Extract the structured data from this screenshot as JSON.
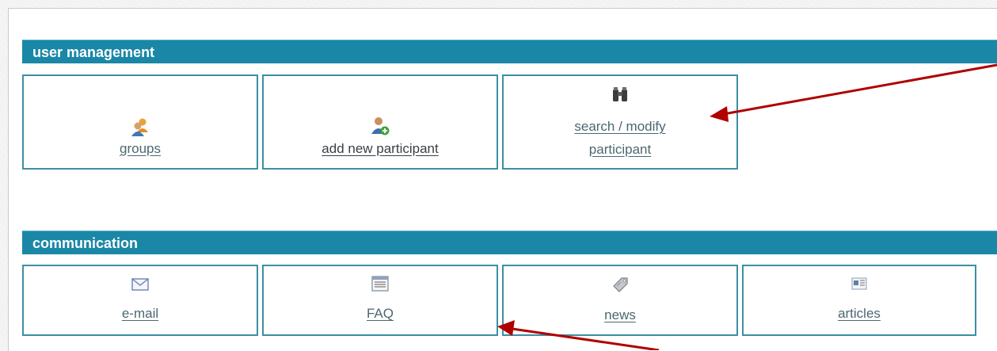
{
  "user_management": {
    "header": "user management",
    "tiles": [
      {
        "label": "groups",
        "icon": "groups-icon"
      },
      {
        "label": "add new participant",
        "icon": "add-user-icon"
      },
      {
        "label_line1": "search / modify",
        "label_line2": "participant",
        "icon": "binoculars-icon"
      }
    ]
  },
  "communication": {
    "header": "communication",
    "tiles": [
      {
        "label": "e-mail",
        "icon": "envelope-icon"
      },
      {
        "label": "FAQ",
        "icon": "faq-list-icon"
      },
      {
        "label": "news",
        "icon": "news-tag-icon"
      },
      {
        "label": "articles",
        "icon": "article-icon"
      }
    ]
  },
  "colors": {
    "header_bg": "#1b87a6",
    "tile_border": "#3c8fa4",
    "link_text": "#4b6870",
    "annotation_arrow": "#b00000"
  }
}
